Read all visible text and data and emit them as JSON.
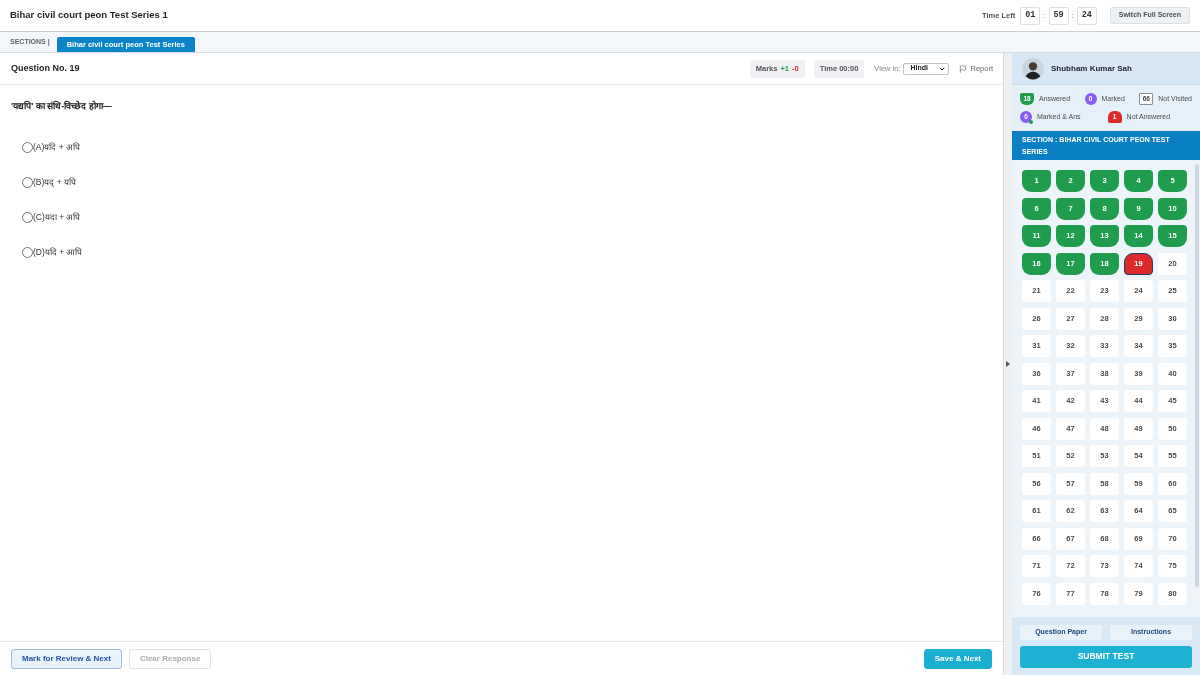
{
  "header": {
    "title": "Bihar civil court peon Test Series 1",
    "timer": {
      "label": "Time Left",
      "parts": [
        {
          "kind": "digits",
          "text": "01"
        },
        {
          "kind": "separator",
          "text": ":"
        },
        {
          "kind": "digits",
          "text": "59"
        },
        {
          "kind": "separator",
          "text": ":"
        },
        {
          "kind": "digits",
          "text": "24"
        }
      ]
    },
    "fullscreen_button": "Switch Full Screen"
  },
  "sections": {
    "label": "SECTIONS |",
    "tabs": [
      {
        "label": "Bihar civil court peon Test Series",
        "selected": true
      }
    ]
  },
  "question": {
    "number_label": "Question No. 19",
    "marks": {
      "label": "Marks",
      "positive": "+1",
      "negative": "-0"
    },
    "time": "Time 00:00",
    "view_in": {
      "label": "View in:",
      "value": "Hindi"
    },
    "report": "Report",
    "text": "'यद्यपि' का संधि-विच्छेद होगा—",
    "options": [
      {
        "label": "(A)यदि + अपि",
        "selected": false
      },
      {
        "label": "(B)यद् + यपि",
        "selected": false
      },
      {
        "label": "(C)यदा + अपि",
        "selected": false
      },
      {
        "label": "(D)यदि + आपि",
        "selected": false
      }
    ]
  },
  "footer": {
    "buttons": [
      {
        "kind": "review",
        "label": "Mark for Review & Next",
        "disabled": false
      },
      {
        "kind": "clear",
        "label": "Clear Response",
        "disabled": true
      },
      {
        "kind": "save",
        "label": "Save & Next",
        "disabled": false
      }
    ]
  },
  "panel": {
    "user_name": "Shubham Kumar Sah",
    "legend": [
      {
        "kind": "answered",
        "count": "18",
        "label": "Answered"
      },
      {
        "kind": "marked",
        "count": "0",
        "label": "Marked"
      },
      {
        "kind": "unvisited",
        "count": "66",
        "label": "Not Visited"
      },
      {
        "kind": "markedanswered",
        "count": "0",
        "label": "Marked & Ans"
      },
      {
        "kind": "unanswered",
        "count": "1",
        "label": "Not Answered"
      }
    ],
    "section_title": "SECTION : BIHAR CIVIL COURT PEON TEST SERIES",
    "questions": [
      {
        "number": "1",
        "kind": "answered",
        "selected": false
      },
      {
        "number": "2",
        "kind": "answered",
        "selected": false
      },
      {
        "number": "3",
        "kind": "answered",
        "selected": false
      },
      {
        "number": "4",
        "kind": "answered",
        "selected": false
      },
      {
        "number": "5",
        "kind": "answered",
        "selected": false
      },
      {
        "number": "6",
        "kind": "answered",
        "selected": false
      },
      {
        "number": "7",
        "kind": "answered",
        "selected": false
      },
      {
        "number": "8",
        "kind": "answered",
        "selected": false
      },
      {
        "number": "9",
        "kind": "answered",
        "selected": false
      },
      {
        "number": "10",
        "kind": "answered",
        "selected": false
      },
      {
        "number": "11",
        "kind": "answered",
        "selected": false
      },
      {
        "number": "12",
        "kind": "answered",
        "selected": false
      },
      {
        "number": "13",
        "kind": "answered",
        "selected": false
      },
      {
        "number": "14",
        "kind": "answered",
        "selected": false
      },
      {
        "number": "15",
        "kind": "answered",
        "selected": false
      },
      {
        "number": "16",
        "kind": "answered",
        "selected": false
      },
      {
        "number": "17",
        "kind": "answered",
        "selected": false
      },
      {
        "number": "18",
        "kind": "answered",
        "selected": false
      },
      {
        "number": "19",
        "kind": "unanswered",
        "selected": true
      },
      {
        "number": "20",
        "kind": "unvisited",
        "selected": false
      },
      {
        "number": "21",
        "kind": "unvisited",
        "selected": false
      },
      {
        "number": "22",
        "kind": "unvisited",
        "selected": false
      },
      {
        "number": "23",
        "kind": "unvisited",
        "selected": false
      },
      {
        "number": "24",
        "kind": "unvisited",
        "selected": false
      },
      {
        "number": "25",
        "kind": "unvisited",
        "selected": false
      },
      {
        "number": "26",
        "kind": "unvisited",
        "selected": false
      },
      {
        "number": "27",
        "kind": "unvisited",
        "selected": false
      },
      {
        "number": "28",
        "kind": "unvisited",
        "selected": false
      },
      {
        "number": "29",
        "kind": "unvisited",
        "selected": false
      },
      {
        "number": "30",
        "kind": "unvisited",
        "selected": false
      },
      {
        "number": "31",
        "kind": "unvisited",
        "selected": false
      },
      {
        "number": "32",
        "kind": "unvisited",
        "selected": false
      },
      {
        "number": "33",
        "kind": "unvisited",
        "selected": false
      },
      {
        "number": "34",
        "kind": "unvisited",
        "selected": false
      },
      {
        "number": "35",
        "kind": "unvisited",
        "selected": false
      },
      {
        "number": "36",
        "kind": "unvisited",
        "selected": false
      },
      {
        "number": "37",
        "kind": "unvisited",
        "selected": false
      },
      {
        "number": "38",
        "kind": "unvisited",
        "selected": false
      },
      {
        "number": "39",
        "kind": "unvisited",
        "selected": false
      },
      {
        "number": "40",
        "kind": "unvisited",
        "selected": false
      },
      {
        "number": "41",
        "kind": "unvisited",
        "selected": false
      },
      {
        "number": "42",
        "kind": "unvisited",
        "selected": false
      },
      {
        "number": "43",
        "kind": "unvisited",
        "selected": false
      },
      {
        "number": "44",
        "kind": "unvisited",
        "selected": false
      },
      {
        "number": "45",
        "kind": "unvisited",
        "selected": false
      },
      {
        "number": "46",
        "kind": "unvisited",
        "selected": false
      },
      {
        "number": "47",
        "kind": "unvisited",
        "selected": false
      },
      {
        "number": "48",
        "kind": "unvisited",
        "selected": false
      },
      {
        "number": "49",
        "kind": "unvisited",
        "selected": false
      },
      {
        "number": "50",
        "kind": "unvisited",
        "selected": false
      },
      {
        "number": "51",
        "kind": "unvisited",
        "selected": false
      },
      {
        "number": "52",
        "kind": "unvisited",
        "selected": false
      },
      {
        "number": "53",
        "kind": "unvisited",
        "selected": false
      },
      {
        "number": "54",
        "kind": "unvisited",
        "selected": false
      },
      {
        "number": "55",
        "kind": "unvisited",
        "selected": false
      },
      {
        "number": "56",
        "kind": "unvisited",
        "selected": false
      },
      {
        "number": "57",
        "kind": "unvisited",
        "selected": false
      },
      {
        "number": "58",
        "kind": "unvisited",
        "selected": false
      },
      {
        "number": "59",
        "kind": "unvisited",
        "selected": false
      },
      {
        "number": "60",
        "kind": "unvisited",
        "selected": false
      },
      {
        "number": "61",
        "kind": "unvisited",
        "selected": false
      },
      {
        "number": "62",
        "kind": "unvisited",
        "selected": false
      },
      {
        "number": "63",
        "kind": "unvisited",
        "selected": false
      },
      {
        "number": "64",
        "kind": "unvisited",
        "selected": false
      },
      {
        "number": "65",
        "kind": "unvisited",
        "selected": false
      },
      {
        "number": "66",
        "kind": "unvisited",
        "selected": false
      },
      {
        "number": "67",
        "kind": "unvisited",
        "selected": false
      },
      {
        "number": "68",
        "kind": "unvisited",
        "selected": false
      },
      {
        "number": "69",
        "kind": "unvisited",
        "selected": false
      },
      {
        "number": "70",
        "kind": "unvisited",
        "selected": false
      },
      {
        "number": "71",
        "kind": "unvisited",
        "selected": false
      },
      {
        "number": "72",
        "kind": "unvisited",
        "selected": false
      },
      {
        "number": "73",
        "kind": "unvisited",
        "selected": false
      },
      {
        "number": "74",
        "kind": "unvisited",
        "selected": false
      },
      {
        "number": "75",
        "kind": "unvisited",
        "selected": false
      },
      {
        "number": "76",
        "kind": "unvisited",
        "selected": false
      },
      {
        "number": "77",
        "kind": "unvisited",
        "selected": false
      },
      {
        "number": "78",
        "kind": "unvisited",
        "selected": false
      },
      {
        "number": "79",
        "kind": "unvisited",
        "selected": false
      },
      {
        "number": "80",
        "kind": "unvisited",
        "selected": false
      }
    ],
    "links": [
      "Question Paper",
      "Instructions"
    ],
    "submit": "SUBMIT TEST"
  }
}
